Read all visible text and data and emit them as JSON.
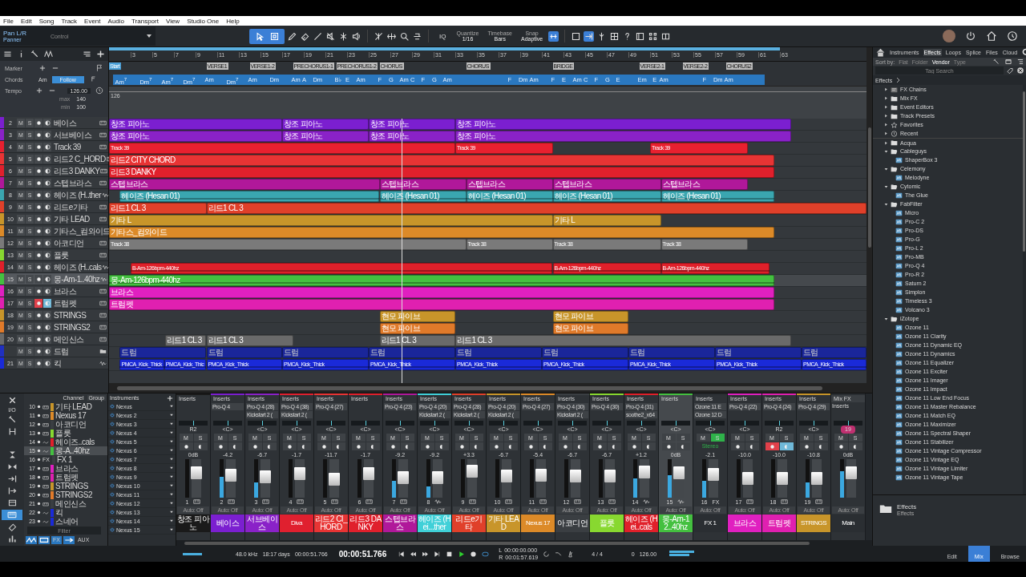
{
  "menu": [
    "File",
    "Edit",
    "Song",
    "Track",
    "Event",
    "Audio",
    "Transport",
    "View",
    "Studio One",
    "Help"
  ],
  "toolbar": {
    "control_name": "Pan L/R",
    "control_type": "Panner",
    "control_label": "Control",
    "quantize": {
      "label": "Quantize",
      "value": "1/16"
    },
    "timebase": {
      "label": "Timebase",
      "value": "Bars"
    },
    "snap": {
      "label": "Snap",
      "value": "Adaptive"
    },
    "iq": "IQ"
  },
  "global_tracks": {
    "marker": "Marker",
    "chords": "Chords",
    "chord_value": "Am",
    "follow": "Follow",
    "tempo": "Tempo",
    "tempo_value": "126.00",
    "max_label": "max",
    "max": "140",
    "min_label": "min",
    "min": "100"
  },
  "ruler": [
    "3",
    "5",
    "7",
    "9",
    "11",
    "13",
    "15",
    "17",
    "19",
    "21",
    "23",
    "25",
    "27",
    "29",
    "31",
    "33",
    "35",
    "37",
    "39",
    "41",
    "43",
    "45",
    "47",
    "49",
    "51",
    "53",
    "55",
    "57",
    "59",
    "61",
    "63"
  ],
  "markers": [
    "Start",
    "VERSE1",
    "VERSE1-2",
    "PRECHORUS1-1",
    "PRECHORUS1-2",
    "CHORUS",
    "CHORUS",
    "BRIDGE",
    "VERSE2-1",
    "VERSE2-2",
    "CHORUS2"
  ],
  "chords": [
    "Am$^{7}$",
    "Dm$^{7}$",
    "Am$^{7}$",
    "Dm$^{7}$",
    "Am",
    "Dm$^{7}$",
    "Am",
    "Dm",
    "Am",
    "A",
    "Dm",
    "B♭",
    "E",
    "Am",
    "F",
    "G",
    "Am",
    "C",
    "F",
    "G",
    "Am",
    "F",
    "Dm",
    "Am",
    "F",
    "E",
    "Am",
    "C",
    "F",
    "G",
    "E",
    "Em",
    "E",
    "Am",
    "F",
    "Dm",
    "Am"
  ],
  "tempo_lane": {
    "value": "126"
  },
  "tracks": [
    {
      "number": "2",
      "name": "베이스",
      "color": "#7b1fd0",
      "kind": "instrument",
      "mute": "M",
      "solo": "S",
      "selected": false,
      "armed": false,
      "monitor": false,
      "clips": [
        "창조 피아노",
        "창조 피아노",
        "창조 피아노",
        "창조 피아노"
      ]
    },
    {
      "number": "3",
      "name": "서브베이스",
      "color": "#8a22c8",
      "kind": "instrument",
      "mute": "M",
      "solo": "S",
      "selected": false,
      "armed": false,
      "monitor": false,
      "clips": [
        "창조 피아노",
        "창조 피아노",
        "창조 피아노",
        "창조 피아노"
      ]
    },
    {
      "number": "4",
      "name": "Track 39",
      "color": "#e8202f",
      "kind": "instrument",
      "mute": "M",
      "solo": "S",
      "selected": false,
      "armed": false,
      "monitor": false,
      "clips": [
        "Track 39",
        "Track 39",
        "Track 39"
      ]
    },
    {
      "number": "5",
      "name": "리드2 C_HORD",
      "color": "#e83434",
      "kind": "instrument",
      "mute": "M",
      "solo": "S",
      "selected": false,
      "armed": false,
      "monitor": false,
      "clips": [
        "리드2 CITY CHORD"
      ]
    },
    {
      "number": "6",
      "name": "리드3  DANKY",
      "color": "#e0202c",
      "kind": "instrument",
      "mute": "M",
      "solo": "S",
      "selected": false,
      "armed": false,
      "monitor": false,
      "clips": [
        "리드3 DANKY"
      ]
    },
    {
      "number": "7",
      "name": "스텝브라스",
      "color": "#b0189a",
      "kind": "instrument",
      "mute": "M",
      "solo": "S",
      "selected": false,
      "armed": false,
      "monitor": false,
      "clips": [
        "스텝브라스",
        "스텝브라스",
        "스텝브라스",
        "스텝브라스",
        "스텝브라스"
      ]
    },
    {
      "number": "8",
      "name": "헤이즈 (H..ther",
      "color": "#3aa6b0",
      "kind": "audio",
      "mute": "M",
      "solo": "S",
      "selected": false,
      "armed": false,
      "monitor": false,
      "clips": [
        "헤이즈 (Hesan 01)",
        "헤이즈 (Hesan 01)",
        "헤이즈 (Hesan 01)",
        "헤이즈 (Hesan 01)",
        "헤이즈 (Hesan 01)"
      ]
    },
    {
      "number": "9",
      "name": "리드e기타",
      "color": "#e0402a",
      "kind": "instrument",
      "mute": "M",
      "solo": "S",
      "selected": false,
      "armed": false,
      "monitor": false,
      "clips": [
        "리드1 CL 3",
        "리드1 CL 3"
      ]
    },
    {
      "number": "10",
      "name": "기타 LEAD",
      "color": "#c8952a",
      "kind": "instrument",
      "mute": "M",
      "solo": "S",
      "selected": false,
      "armed": false,
      "monitor": false,
      "clips": [
        "기타 L",
        "기타 L"
      ]
    },
    {
      "number": "11",
      "name": "기타스_컴와이드",
      "color": "#dc8a28",
      "kind": "instrument",
      "mute": "M",
      "solo": "S",
      "selected": false,
      "armed": false,
      "monitor": false,
      "clips": [
        "기타스_컴와이드"
      ]
    },
    {
      "number": "12",
      "name": "아코디언",
      "color": "#7a7a7a",
      "kind": "instrument",
      "mute": "M",
      "solo": "S",
      "selected": false,
      "armed": false,
      "monitor": false,
      "clips": [
        "Track 38",
        "Track 38",
        "Track 38",
        "Track 38"
      ]
    },
    {
      "number": "13",
      "name": "플룻",
      "color": "#88d830",
      "kind": "instrument",
      "mute": "M",
      "solo": "S",
      "selected": false,
      "armed": false,
      "monitor": false
    },
    {
      "number": "14",
      "name": "헤이즈 (H..cals",
      "color": "#e0202a",
      "kind": "audio",
      "mute": "M",
      "solo": "S",
      "selected": false,
      "armed": false,
      "monitor": false,
      "clips": [
        "B-Am-126bpm-440hz",
        "B-Am-126bpm-440hz",
        "B-Am-126bpm-440hz"
      ]
    },
    {
      "number": "15",
      "name": "몽-Am-1..40hz",
      "color": "#44c040",
      "kind": "audio",
      "mute": "M",
      "solo": "S",
      "selected": true,
      "armed": false,
      "monitor": false,
      "clips": [
        "몽-Am-126bpm-440hz"
      ]
    },
    {
      "number": "16",
      "name": "브라스",
      "color": "#e020c0",
      "kind": "instrument",
      "mute": "M",
      "solo": "S",
      "selected": false,
      "armed": false,
      "monitor": false,
      "clips": [
        "브라스"
      ]
    },
    {
      "number": "17",
      "name": "트럼펫",
      "color": "#e020b0",
      "kind": "instrument",
      "mute": "M",
      "solo": "S",
      "selected": false,
      "armed": true,
      "monitor": true,
      "clips": [
        "트럼펫"
      ]
    },
    {
      "number": "18",
      "name": "STRINGS",
      "color": "#c8952a",
      "kind": "instrument",
      "mute": "M",
      "solo": "S",
      "selected": false,
      "armed": false,
      "monitor": false,
      "clips": [
        "현모 파이브",
        "현모 파이브"
      ]
    },
    {
      "number": "19",
      "name": "STRINGS2",
      "color": "#e07a2a",
      "kind": "instrument",
      "mute": "M",
      "solo": "S",
      "selected": false,
      "armed": false,
      "monitor": false,
      "clips": [
        "현모 파이브",
        "현모 파이브"
      ]
    },
    {
      "number": "20",
      "name": "메인신스",
      "color": "#6a6a6a",
      "kind": "instrument",
      "mute": "M",
      "solo": "S",
      "selected": false,
      "armed": false,
      "monitor": false,
      "clips": [
        "리드1 CL 3",
        "리드1 CL 3",
        "리드1 CL 3",
        "리드1 CL 3"
      ]
    },
    {
      "name": "드럼",
      "color": "#2030c0",
      "kind": "folder",
      "mute": "M",
      "solo": "S",
      "selected": false,
      "armed": false,
      "monitor": false,
      "clips": [
        "드럼",
        "드럼",
        "드럼",
        "드럼",
        "드럼",
        "드럼",
        "드럼",
        "드럼",
        "드럼"
      ]
    },
    {
      "number": "21",
      "name": "킥",
      "color": "#1a2ad8",
      "kind": "audio",
      "mute": "M",
      "solo": "S",
      "selected": false,
      "armed": false,
      "monitor": false,
      "clips": [
        "PMCA_Kick_Thick",
        "PMCA_Kick_Thic",
        "PMCA_Kick_Thick",
        "PMCA_Kick_Thick",
        "PMCA_Kick_Thick",
        "PMCA_Kick_Thick",
        "PMCA_Kick_Thick",
        "PMCA_Kick_Thick",
        "PMCA_Kick_Thick",
        "PMCA_Kick_Thick"
      ]
    }
  ],
  "browser": {
    "tabs": [
      {
        "label": "Instruments",
        "selected": false
      },
      {
        "label": "Effects",
        "selected": true
      },
      {
        "label": "Loops",
        "selected": false
      },
      {
        "label": "Splice",
        "selected": false
      },
      {
        "label": "Files",
        "selected": false
      },
      {
        "label": "Cloud",
        "selected": false
      }
    ],
    "sort_label": "Sort by:",
    "sort": [
      {
        "label": "Flat",
        "selected": false
      },
      {
        "label": "Folder",
        "selected": false
      },
      {
        "label": "Vendor",
        "selected": true
      },
      {
        "label": "Type",
        "selected": false
      }
    ],
    "search": {
      "placeholder": "Tag Search"
    },
    "breadcrumb": "Effects",
    "tree": [
      {
        "label": "FX Chains",
        "kind": "chains",
        "expanded": false
      },
      {
        "label": "Mix FX",
        "kind": "folder",
        "expanded": false
      },
      {
        "label": "Event Editors",
        "kind": "folder",
        "expanded": false
      },
      {
        "label": "Track Presets",
        "kind": "folder",
        "expanded": false
      },
      {
        "label": "Favorites",
        "kind": "favorites",
        "expanded": false
      },
      {
        "label": "Recent",
        "kind": "recent",
        "expanded": false
      },
      {
        "label": "Acqua",
        "kind": "vendor",
        "expanded": false
      },
      {
        "label": "Cableguys",
        "kind": "vendor",
        "expanded": true,
        "children": [
          {
            "label": "ShaperBox 3",
            "kind": "plugin"
          }
        ]
      },
      {
        "label": "Celemony",
        "kind": "vendor",
        "expanded": true,
        "children": [
          {
            "label": "Melodyne",
            "kind": "plugin"
          }
        ]
      },
      {
        "label": "Cytomic",
        "kind": "vendor",
        "expanded": true,
        "children": [
          {
            "label": "The Glue",
            "kind": "plugin"
          }
        ]
      },
      {
        "label": "FabFilter",
        "kind": "vendor",
        "expanded": true,
        "children": [
          {
            "label": "Micro",
            "kind": "plugin"
          },
          {
            "label": "Pro-C 2",
            "kind": "plugin"
          },
          {
            "label": "Pro-DS",
            "kind": "plugin"
          },
          {
            "label": "Pro-G",
            "kind": "plugin"
          },
          {
            "label": "Pro-L 2",
            "kind": "plugin"
          },
          {
            "label": "Pro-MB",
            "kind": "plugin"
          },
          {
            "label": "Pro-Q 4",
            "kind": "plugin"
          },
          {
            "label": "Pro-R 2",
            "kind": "plugin"
          },
          {
            "label": "Saturn 2",
            "kind": "plugin"
          },
          {
            "label": "Simplon",
            "kind": "plugin"
          },
          {
            "label": "Timeless 3",
            "kind": "plugin"
          },
          {
            "label": "Volcano 3",
            "kind": "plugin"
          }
        ]
      },
      {
        "label": "iZotope",
        "kind": "vendor",
        "expanded": true,
        "children": [
          {
            "label": "Ozone 11",
            "kind": "plugin"
          },
          {
            "label": "Ozone 11 Clarity",
            "kind": "plugin"
          },
          {
            "label": "Ozone 11 Dynamic EQ",
            "kind": "plugin"
          },
          {
            "label": "Ozone 11 Dynamics",
            "kind": "plugin"
          },
          {
            "label": "Ozone 11 Equalizer",
            "kind": "plugin"
          },
          {
            "label": "Ozone 11 Exciter",
            "kind": "plugin"
          },
          {
            "label": "Ozone 11 Imager",
            "kind": "plugin"
          },
          {
            "label": "Ozone 11 Impact",
            "kind": "plugin"
          },
          {
            "label": "Ozone 11 Low End Focus",
            "kind": "plugin"
          },
          {
            "label": "Ozone 11 Master Rebalance",
            "kind": "plugin"
          },
          {
            "label": "Ozone 11 Match EQ",
            "kind": "plugin"
          },
          {
            "label": "Ozone 11 Maximizer",
            "kind": "plugin"
          },
          {
            "label": "Ozone 11 Spectral Shaper",
            "kind": "plugin"
          },
          {
            "label": "Ozone 11 Stabilizer",
            "kind": "plugin"
          },
          {
            "label": "Ozone 11 Vintage Compressor",
            "kind": "plugin"
          },
          {
            "label": "Ozone 11 Vintage EQ",
            "kind": "plugin"
          },
          {
            "label": "Ozone 11 Vintage Limiter",
            "kind": "plugin"
          },
          {
            "label": "Ozone 11 Vintage Tape",
            "kind": "plugin"
          }
        ]
      }
    ],
    "footer": {
      "title": "Effects",
      "subtitle": "Effects"
    }
  },
  "mixer": {
    "channel_header": "Channel",
    "group_header": "Group",
    "io": "I/O",
    "filter": {
      "placeholder": "Filter"
    },
    "aux": "AUX",
    "fx": "FX",
    "channels": [
      {
        "number": "10",
        "name": "기타 LEAD",
        "color": "#c8952a",
        "kind": "instrument",
        "selected": false
      },
      {
        "number": "11",
        "name": "Nexus 17",
        "color": "#dc8a28",
        "kind": "instrument",
        "selected": false
      },
      {
        "number": "12",
        "name": "아코디언",
        "color": "#3a3e42",
        "kind": "instrument",
        "selected": false
      },
      {
        "number": "13",
        "name": "플룻",
        "color": "#88d830",
        "kind": "instrument",
        "selected": false
      },
      {
        "number": "14",
        "name": "헤이즈..cals",
        "color": "#e0202a",
        "kind": "audio",
        "selected": false
      },
      {
        "number": "15",
        "name": "몽-A..40hz",
        "color": "#44c040",
        "kind": "audio",
        "selected": true
      },
      {
        "number": "16",
        "name": "FX 1",
        "color": "#3a3e42",
        "kind": "fx",
        "badge": "FX",
        "selected": false
      },
      {
        "number": "17",
        "name": "브라스",
        "color": "#e020c0",
        "kind": "instrument",
        "selected": false
      },
      {
        "number": "18",
        "name": "트럼펫",
        "color": "#e020b0",
        "kind": "instrument",
        "selected": false
      },
      {
        "number": "19",
        "name": "STRINGS",
        "color": "#c8952a",
        "kind": "instrument",
        "selected": false
      },
      {
        "number": "20",
        "name": "STRINGS2",
        "color": "#e07a2a",
        "kind": "instrument",
        "selected": false
      },
      {
        "number": "21",
        "name": "메인신스",
        "color": "#3a3e42",
        "kind": "instrument",
        "selected": false
      },
      {
        "number": "22",
        "name": "킥",
        "color": "#1a2ad8",
        "kind": "audio",
        "selected": false
      },
      {
        "number": "23",
        "name": "스네어",
        "color": "#1a2ad8",
        "kind": "audio",
        "selected": false
      }
    ],
    "instruments_header": "Instruments",
    "instruments": [
      "Nexus",
      "Nexus 2",
      "Nexus 3",
      "Nexus 4",
      "Nexus 5",
      "Nexus 6",
      "Nexus 7",
      "Nexus 8",
      "Nexus 9",
      "Nexus 10",
      "Nexus 11",
      "Nexus 12",
      "Nexus 13",
      "Nexus 14",
      "Nexus 15"
    ],
    "strips": [
      {
        "header": "Inserts",
        "number": "1",
        "name": "창조 피아노",
        "color": "#1a1a1a",
        "kind": "instrument",
        "pan": "R2",
        "mute": "M",
        "solo": "S",
        "volume": "0dB",
        "auto": "Auto: Off",
        "fader": {
          "level": 0.72
        },
        "selected": false,
        "soloed": false,
        "armed": false,
        "monitor": false
      },
      {
        "header": "Inserts",
        "number": "2",
        "name": "베이스",
        "color": "#7b1fd0",
        "kind": "instrument",
        "pan": "<C>",
        "mute": "M",
        "solo": "S",
        "volume": "-4.2",
        "auto": "Auto: Off",
        "inserts": [
          "Pro-Q 4"
        ],
        "fader": {
          "level": 0.64
        },
        "meter": {
          "level": 0.55
        },
        "selected": false,
        "soloed": false,
        "armed": false,
        "monitor": false
      },
      {
        "header": "Inserts",
        "number": "3",
        "name": "서브베이스",
        "color": "#8a22c8",
        "kind": "instrument",
        "pan": "<C>",
        "mute": "M",
        "solo": "S",
        "volume": "-6.7",
        "auto": "Auto: Off",
        "inserts": [
          "Pro-Q 4 (28)",
          "Kickstart 2 ("
        ],
        "fader": {
          "level": 0.58
        },
        "meter": {
          "level": 0.4
        },
        "selected": false,
        "soloed": false,
        "armed": false,
        "monitor": false
      },
      {
        "header": "Inserts",
        "number": "4",
        "name": "Diva",
        "color": "#e0202f",
        "kind": "instrument",
        "pan": "<C>",
        "mute": "M",
        "solo": "S",
        "volume": "-1.7",
        "auto": "Auto: Off",
        "inserts": [
          "Pro-Q 4 (38)",
          "Kickstart 2 ("
        ],
        "fader": {
          "level": 0.7
        },
        "selected": false,
        "soloed": false,
        "armed": false,
        "monitor": false
      },
      {
        "header": "Inserts",
        "number": "5",
        "name": "리드2 CI_HORD",
        "color": "#e83434",
        "kind": "instrument",
        "pan": "<C>",
        "mute": "M",
        "solo": "S",
        "volume": "-11.7",
        "auto": "Auto: Off",
        "inserts": [
          "Pro-Q 4 (27)"
        ],
        "fader": {
          "level": 0.48
        },
        "selected": false,
        "soloed": false,
        "armed": false,
        "monitor": false
      },
      {
        "header": "Inserts",
        "number": "6",
        "name": "리드3  DANKY",
        "color": "#e0202c",
        "kind": "instrument",
        "pan": "<C>",
        "mute": "M",
        "solo": "S",
        "volume": "-1.7",
        "auto": "Auto: Off",
        "fader": {
          "level": 0.7
        },
        "selected": false,
        "soloed": false,
        "armed": false,
        "monitor": false
      },
      {
        "header": "Inserts",
        "number": "7",
        "name": "스텝브라스",
        "color": "#b0189a",
        "kind": "instrument",
        "pan": "<C>",
        "mute": "M",
        "solo": "S",
        "volume": "-9.2",
        "auto": "Auto: Off",
        "inserts": [
          "Pro-Q 4 (23)"
        ],
        "fader": {
          "level": 0.55
        },
        "meter": {
          "level": 0.45
        },
        "selected": false,
        "soloed": false,
        "armed": false,
        "monitor": false
      },
      {
        "header": "Inserts",
        "number": "8",
        "name": "헤이즈 (Hei...ther",
        "color": "#40d0d8",
        "kind": "audio",
        "pan": "<C>",
        "mute": "M",
        "solo": "S",
        "volume": "-9.2",
        "auto": "Auto: Off",
        "inserts": [
          "Pro-Q 4 (20)",
          "Kickstart 2 ("
        ],
        "fader": {
          "level": 0.55
        },
        "meter": {
          "level": 0.3
        },
        "selected": false,
        "soloed": false,
        "armed": false,
        "monitor": false
      },
      {
        "header": "Inserts",
        "number": "9",
        "name": "리드e기타",
        "color": "#e0402a",
        "kind": "instrument",
        "pan": "<C>",
        "mute": "M",
        "solo": "S",
        "volume": "+3.3",
        "auto": "Auto: Off",
        "inserts": [
          "Pro-Q 4 (28)",
          "Kickstart 2 ("
        ],
        "fader": {
          "level": 0.8
        },
        "selected": false,
        "soloed": false,
        "armed": false,
        "monitor": false
      },
      {
        "header": "Inserts",
        "number": "10",
        "name": "기타 LEAD",
        "color": "#c8952a",
        "kind": "instrument",
        "pan": "<C>",
        "mute": "M",
        "solo": "S",
        "volume": "-6.7",
        "auto": "Auto: Off",
        "inserts": [
          "Pro-Q 4 (20)",
          "Kickstart 2 ("
        ],
        "fader": {
          "level": 0.6
        },
        "selected": false,
        "soloed": false,
        "armed": false,
        "monitor": false
      },
      {
        "header": "Inserts",
        "number": "11",
        "name": "Nexus 17",
        "color": "#dc8a28",
        "kind": "instrument",
        "pan": "<C>",
        "mute": "M",
        "solo": "S",
        "volume": "-5.4",
        "auto": "Auto: Off",
        "inserts": [
          "Pro-Q 4 (27)"
        ],
        "fader": {
          "level": 0.62
        },
        "selected": false,
        "soloed": false,
        "armed": false,
        "monitor": false
      },
      {
        "header": "Inserts",
        "number": "12",
        "name": "아코디언",
        "color": "#3a3e42",
        "kind": "instrument",
        "pan": "<C>",
        "mute": "M",
        "solo": "S",
        "volume": "-6.7",
        "auto": "Auto: Off",
        "inserts": [
          "Pro-Q 4 (30)",
          "Kickstart 2 ("
        ],
        "fader": {
          "level": 0.6
        },
        "selected": false,
        "soloed": false,
        "armed": false,
        "monitor": false
      },
      {
        "header": "Inserts",
        "number": "13",
        "name": "플룻",
        "color": "#88d830",
        "kind": "instrument",
        "pan": "<C>",
        "mute": "M",
        "solo": "S",
        "volume": "-6.7",
        "auto": "Auto: Off",
        "inserts": [
          "Pro-Q 4 (30)"
        ],
        "fader": {
          "level": 0.6
        },
        "selected": false,
        "soloed": false,
        "armed": false,
        "monitor": false
      },
      {
        "header": "Inserts",
        "number": "14",
        "name": "헤이즈 (Hei..cals",
        "color": "#e0202a",
        "kind": "audio",
        "pan": "<C>",
        "mute": "M",
        "solo": "S",
        "volume": "+1.2",
        "auto": "Auto: Off",
        "inserts": [
          "Pro-Q 4 (31)",
          "soothe2_x64"
        ],
        "fader": {
          "level": 0.76
        },
        "meter": {
          "level": 0.5
        },
        "selected": false,
        "soloed": false,
        "armed": false,
        "monitor": false
      },
      {
        "header": "Inserts",
        "number": "15",
        "name": "몽-Am-12..40hz",
        "color": "#44c040",
        "kind": "audio",
        "pan": "<C>",
        "mute": "M",
        "solo": "S",
        "volume": "0dB",
        "auto": "Auto: Off",
        "fader": {
          "level": 0.72
        },
        "meter": {
          "level": 0.6
        },
        "selected": true,
        "soloed": false,
        "armed": false,
        "monitor": false
      },
      {
        "header": "Inserts",
        "number": "16",
        "badge": "FX",
        "name": "FX 1",
        "color": "#2a2e32",
        "kind": "fx",
        "pan": "<C>",
        "mute": "M",
        "solo": "S",
        "stereo": "Stereo",
        "volume": "-2.1",
        "auto": "Auto: Off",
        "inserts": [
          "Ozone 11 E",
          "Ozone 12 D"
        ],
        "fader": {
          "level": 0.68
        },
        "meter": {
          "level": 0.45
        },
        "selected": false,
        "soloed": true
      },
      {
        "header": "Inserts",
        "number": "17",
        "name": "브라스",
        "color": "#e020c0",
        "kind": "instrument",
        "pan": "<C>",
        "mute": "M",
        "solo": "S",
        "volume": "-10.0",
        "auto": "Auto: Off",
        "inserts": [
          "Pro-Q 4 (22)"
        ],
        "fader": {
          "level": 0.52
        },
        "selected": false,
        "soloed": false,
        "armed": false,
        "monitor": false
      },
      {
        "header": "Inserts",
        "number": "18",
        "name": "트럼펫",
        "color": "#e020b0",
        "kind": "instrument",
        "pan": "R2",
        "mute": "M",
        "solo": "S",
        "volume": "-10.0",
        "auto": "Auto: Off",
        "inserts": [
          "Pro-Q 4 (24)"
        ],
        "fader": {
          "level": 0.52
        },
        "selected": false,
        "soloed": false,
        "armed": true,
        "monitor": true
      },
      {
        "header": "Inserts",
        "number": "19",
        "name": "STRINGS",
        "color": "#c8952a",
        "kind": "instrument",
        "pan": "<C>",
        "mute": "M",
        "solo": "S",
        "volume": "-10.8",
        "auto": "Auto: Off",
        "inserts": [
          "Pro-Q 4 (29)"
        ],
        "fader": {
          "level": 0.5
        },
        "meter": {
          "level": 0.4
        },
        "selected": false,
        "soloed": false,
        "armed": false,
        "monitor": false
      },
      {
        "header": "Mix FX",
        "sub_header": "Inserts",
        "badge": "19",
        "name": "Main",
        "color": "#2a2e32",
        "kind": "main",
        "mute": "M",
        "solo": "S",
        "volume": "0dB",
        "auto": "Auto: Off",
        "fader": {
          "level": 0.72
        },
        "meter": {
          "level": 0.7
        },
        "selected": false,
        "soloed": false,
        "armed": false,
        "monitor": false
      }
    ]
  },
  "transport": {
    "sample_rate": "48.0 kHz",
    "record_time": "18:17 days",
    "seconds": "00:00:51.766",
    "time": "00:00:51.766",
    "left": "00:00:00.000",
    "right": "00:01:57.619",
    "left_label": "L",
    "right_label": "R",
    "signature": "4 / 4",
    "transpose": "0",
    "tempo": "126.00",
    "views": [
      {
        "label": "Edit",
        "selected": false
      },
      {
        "label": "Mix",
        "selected": true
      },
      {
        "label": "Browse",
        "selected": false
      }
    ]
  }
}
